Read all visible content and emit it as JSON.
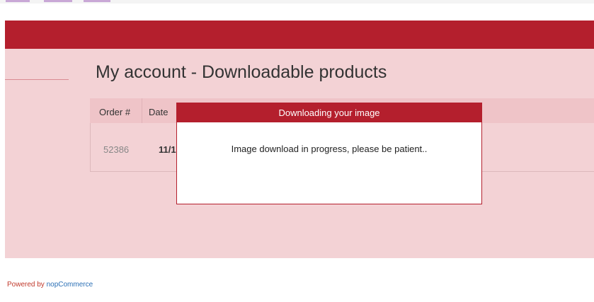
{
  "page": {
    "title": "My account - Downloadable products"
  },
  "table": {
    "headers": [
      "Order #",
      "Date"
    ],
    "rows": [
      {
        "order": "52386",
        "date": "11/1"
      }
    ]
  },
  "dialog": {
    "title": "Downloading your image",
    "message": "Image download in progress, please be patient.."
  },
  "footer": {
    "powered_by": "Powered by",
    "brand_link": "nopCommerce"
  },
  "colors": {
    "brand_red": "#b41f2d",
    "pink_bg": "#f3d2d5",
    "header_pink": "#efc4c8",
    "link_blue": "#2a6fb5"
  }
}
